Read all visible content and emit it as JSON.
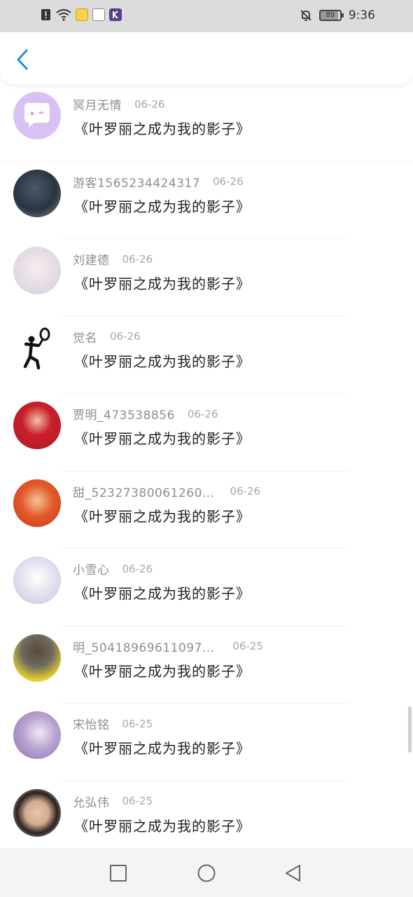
{
  "status_bar": {
    "time": "9:36",
    "battery": "89",
    "icons": [
      "alert-icon",
      "wifi-icon",
      "app-icon-1",
      "app-icon-2",
      "app-icon-k",
      "mute-bell-icon"
    ]
  },
  "header": {
    "back_icon": "chevron-left-icon",
    "accent": "#1e90e8"
  },
  "comments": [
    {
      "name": "冥月无情",
      "date": "06-26",
      "text": "《叶罗丽之成为我的影子》",
      "avatar": "chat-bubble-avatar"
    },
    {
      "name": "游客1565234424317",
      "date": "06-26",
      "text": "《叶罗丽之成为我的影子》",
      "avatar": "photo-avatar"
    },
    {
      "name": "刘建德",
      "date": "06-26",
      "text": "《叶罗丽之成为我的影子》",
      "avatar": "photo-avatar"
    },
    {
      "name": "觉名",
      "date": "06-26",
      "text": "《叶罗丽之成为我的影子》",
      "avatar": "stick-figure-avatar"
    },
    {
      "name": "贾明_473538856",
      "date": "06-26",
      "text": "《叶罗丽之成为我的影子》",
      "avatar": "photo-avatar"
    },
    {
      "name": "甜_52327380061260…",
      "date": "06-26",
      "text": "《叶罗丽之成为我的影子》",
      "avatar": "photo-avatar"
    },
    {
      "name": "小雪心",
      "date": "06-26",
      "text": "《叶罗丽之成为我的影子》",
      "avatar": "photo-avatar"
    },
    {
      "name": "明_50418969611097…",
      "date": "06-25",
      "text": "《叶罗丽之成为我的影子》",
      "avatar": "photo-avatar"
    },
    {
      "name": "宋怡铭",
      "date": "06-25",
      "text": "《叶罗丽之成为我的影子》",
      "avatar": "photo-avatar"
    },
    {
      "name": "允弘伟",
      "date": "06-25",
      "text": "《叶罗丽之成为我的影子》",
      "avatar": "photo-avatar"
    }
  ],
  "nav_bar": {
    "recents_icon": "square-icon",
    "home_icon": "circle-icon",
    "back_icon": "triangle-back-icon"
  }
}
